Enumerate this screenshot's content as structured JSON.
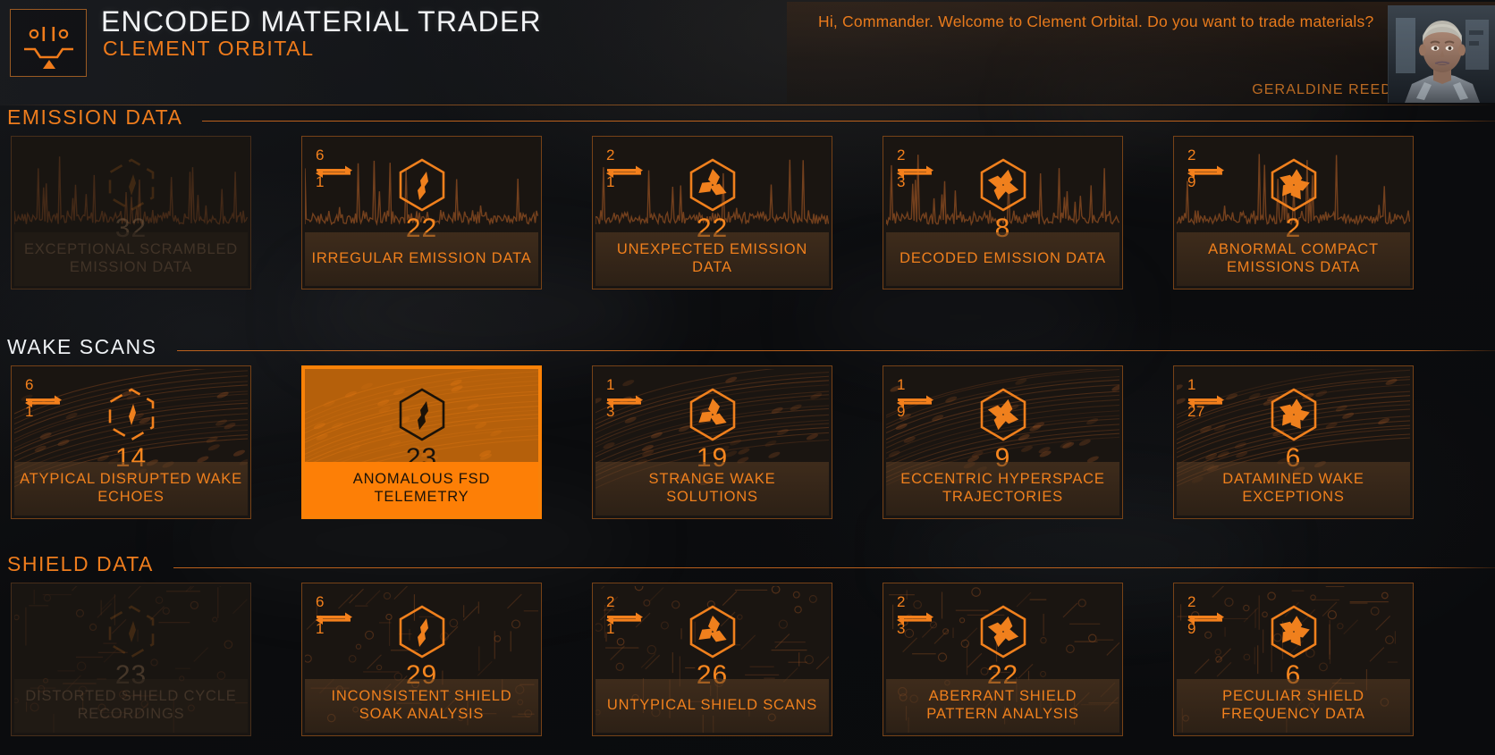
{
  "header": {
    "logo_icon": "material-trader-logo-icon",
    "title": "ENCODED MATERIAL TRADER",
    "station": "CLEMENT ORBITAL",
    "greeting": "Hi, Commander. Welcome to Clement Orbital. Do you want to trade materials?",
    "officer_name": "GERALDINE REED",
    "portrait_alt": "geraldine-reed-portrait"
  },
  "colors": {
    "accent": "#f0801d",
    "accent_bright": "#ff7f00",
    "selected_bg": "#f98209",
    "selected_text": "#1a1208",
    "title_text": "#f2f4f6",
    "dim_text": "#7d6148",
    "panel_bg": "#191512",
    "rule": "#d86e1e"
  },
  "sections": [
    {
      "id": "emission-data",
      "title": "EMISSION DATA",
      "title_style": "accent",
      "art": "waveform",
      "cards": [
        {
          "name": "EXCEPTIONAL SCRAMBLED EMISSION DATA",
          "quantity": "32",
          "grade": 1,
          "grade_icon": "hex-grade-1-icon",
          "ratio_top": "",
          "ratio_bottom": "",
          "has_ratio": false,
          "state": "dim",
          "selected": false
        },
        {
          "name": "IRREGULAR EMISSION DATA",
          "quantity": "22",
          "grade": 2,
          "grade_icon": "hex-grade-2-icon",
          "ratio_top": "6",
          "ratio_bottom": "1",
          "has_ratio": true,
          "state": "normal",
          "selected": false
        },
        {
          "name": "UNEXPECTED EMISSION DATA",
          "quantity": "22",
          "grade": 3,
          "grade_icon": "hex-grade-3-icon",
          "ratio_top": "2",
          "ratio_bottom": "1",
          "has_ratio": true,
          "state": "normal",
          "selected": false
        },
        {
          "name": "DECODED EMISSION DATA",
          "quantity": "8",
          "grade": 4,
          "grade_icon": "hex-grade-4-icon",
          "ratio_top": "2",
          "ratio_bottom": "3",
          "has_ratio": true,
          "state": "normal",
          "selected": false
        },
        {
          "name": "ABNORMAL COMPACT EMISSIONS DATA",
          "quantity": "2",
          "grade": 5,
          "grade_icon": "hex-grade-5-icon",
          "ratio_top": "2",
          "ratio_bottom": "9",
          "has_ratio": true,
          "state": "normal",
          "selected": false
        }
      ]
    },
    {
      "id": "wake-scans",
      "title": "WAKE SCANS",
      "title_style": "light",
      "art": "wake",
      "cards": [
        {
          "name": "ATYPICAL DISRUPTED WAKE ECHOES",
          "quantity": "14",
          "grade": 1,
          "grade_icon": "hex-grade-1-icon",
          "ratio_top": "6",
          "ratio_bottom": "1",
          "has_ratio": true,
          "state": "normal",
          "selected": false
        },
        {
          "name": "ANOMALOUS FSD TELEMETRY",
          "quantity": "23",
          "grade": 2,
          "grade_icon": "hex-grade-2-icon",
          "ratio_top": "",
          "ratio_bottom": "",
          "has_ratio": false,
          "state": "normal",
          "selected": true
        },
        {
          "name": "STRANGE WAKE SOLUTIONS",
          "quantity": "19",
          "grade": 3,
          "grade_icon": "hex-grade-3-icon",
          "ratio_top": "1",
          "ratio_bottom": "3",
          "has_ratio": true,
          "state": "normal",
          "selected": false
        },
        {
          "name": "ECCENTRIC HYPERSPACE TRAJECTORIES",
          "quantity": "9",
          "grade": 4,
          "grade_icon": "hex-grade-4-icon",
          "ratio_top": "1",
          "ratio_bottom": "9",
          "has_ratio": true,
          "state": "normal",
          "selected": false
        },
        {
          "name": "DATAMINED WAKE EXCEPTIONS",
          "quantity": "6",
          "grade": 5,
          "grade_icon": "hex-grade-5-icon",
          "ratio_top": "1",
          "ratio_bottom": "27",
          "has_ratio": true,
          "state": "normal",
          "selected": false
        }
      ]
    },
    {
      "id": "shield-data",
      "title": "SHIELD DATA",
      "title_style": "accent",
      "art": "circuit",
      "cards": [
        {
          "name": "DISTORTED SHIELD CYCLE RECORDINGS",
          "quantity": "23",
          "grade": 1,
          "grade_icon": "hex-grade-1-icon",
          "ratio_top": "",
          "ratio_bottom": "",
          "has_ratio": false,
          "state": "dim",
          "selected": false
        },
        {
          "name": "INCONSISTENT SHIELD SOAK ANALYSIS",
          "quantity": "29",
          "grade": 2,
          "grade_icon": "hex-grade-2-icon",
          "ratio_top": "6",
          "ratio_bottom": "1",
          "has_ratio": true,
          "state": "normal",
          "selected": false
        },
        {
          "name": "UNTYPICAL SHIELD SCANS",
          "quantity": "26",
          "grade": 3,
          "grade_icon": "hex-grade-3-icon",
          "ratio_top": "2",
          "ratio_bottom": "1",
          "has_ratio": true,
          "state": "normal",
          "selected": false
        },
        {
          "name": "ABERRANT SHIELD PATTERN ANALYSIS",
          "quantity": "22",
          "grade": 4,
          "grade_icon": "hex-grade-4-icon",
          "ratio_top": "2",
          "ratio_bottom": "3",
          "has_ratio": true,
          "state": "normal",
          "selected": false
        },
        {
          "name": "PECULIAR SHIELD FREQUENCY DATA",
          "quantity": "6",
          "grade": 5,
          "grade_icon": "hex-grade-5-icon",
          "ratio_top": "2",
          "ratio_bottom": "9",
          "has_ratio": true,
          "state": "normal",
          "selected": false
        }
      ]
    }
  ]
}
